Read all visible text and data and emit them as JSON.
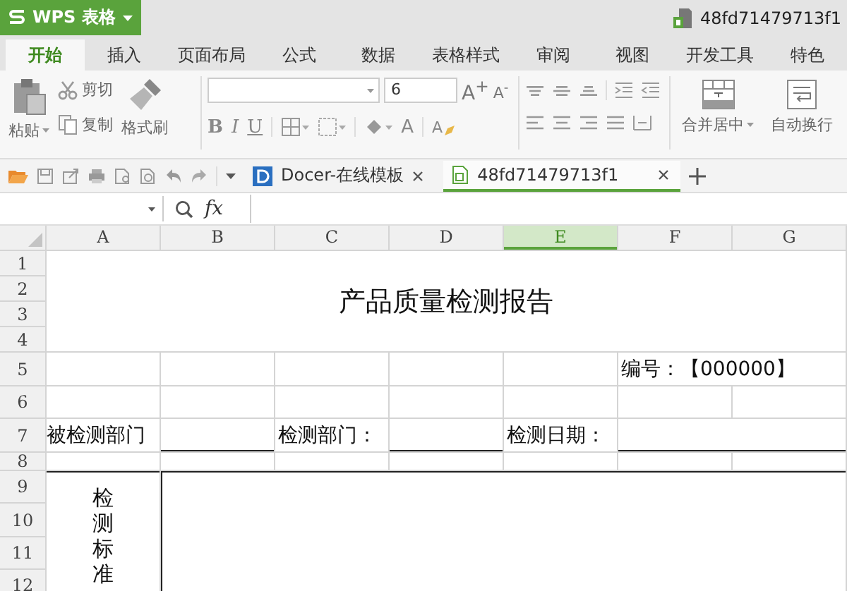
{
  "app": {
    "name": "WPS 表格"
  },
  "document": {
    "title": "48fd71479713f1"
  },
  "ribbon_tabs": [
    {
      "label": "开始",
      "selected": true
    },
    {
      "label": "插入",
      "selected": false
    },
    {
      "label": "页面布局",
      "selected": false
    },
    {
      "label": "公式",
      "selected": false
    },
    {
      "label": "数据",
      "selected": false
    },
    {
      "label": "表格样式",
      "selected": false
    },
    {
      "label": "审阅",
      "selected": false
    },
    {
      "label": "视图",
      "selected": false
    },
    {
      "label": "开发工具",
      "selected": false
    },
    {
      "label": "特色",
      "selected": false
    }
  ],
  "toolbar": {
    "paste": "粘贴",
    "cut": "剪切",
    "copy": "复制",
    "format_painter": "格式刷",
    "font_size": "6",
    "grow_font": "A$^{+}$",
    "shrink_font": "A$^{-}$",
    "format_buttons": [
      {
        "label": "B",
        "kind": "bold"
      },
      {
        "label": "I",
        "kind": "italic"
      },
      {
        "label": "U",
        "kind": "underline"
      }
    ],
    "font_color": "A",
    "highlight": "A",
    "merge_center": "合并居中",
    "wrap_text": "自动换行"
  },
  "doc_tabs": [
    {
      "label": "Docer-在线模板",
      "kind": "docer",
      "selected": false
    },
    {
      "label": "48fd71479713f1",
      "kind": "file",
      "selected": true
    }
  ],
  "formula_bar": {
    "fx": "fx"
  },
  "sheet": {
    "columns": [
      {
        "label": "A",
        "selected": false
      },
      {
        "label": "B",
        "selected": false
      },
      {
        "label": "C",
        "selected": false
      },
      {
        "label": "D",
        "selected": false
      },
      {
        "label": "E",
        "selected": true
      },
      {
        "label": "F",
        "selected": false
      },
      {
        "label": "G",
        "selected": false
      }
    ],
    "rows": [
      "1",
      "2",
      "3",
      "4",
      "5",
      "6",
      "7",
      "8",
      "9",
      "10",
      "11",
      "12"
    ],
    "title": "产品质量检测报告",
    "number": "编号：【000000】",
    "row7": [
      "被检测部门",
      "检测部门：",
      "检测日期："
    ],
    "side_label": "检测标准"
  }
}
